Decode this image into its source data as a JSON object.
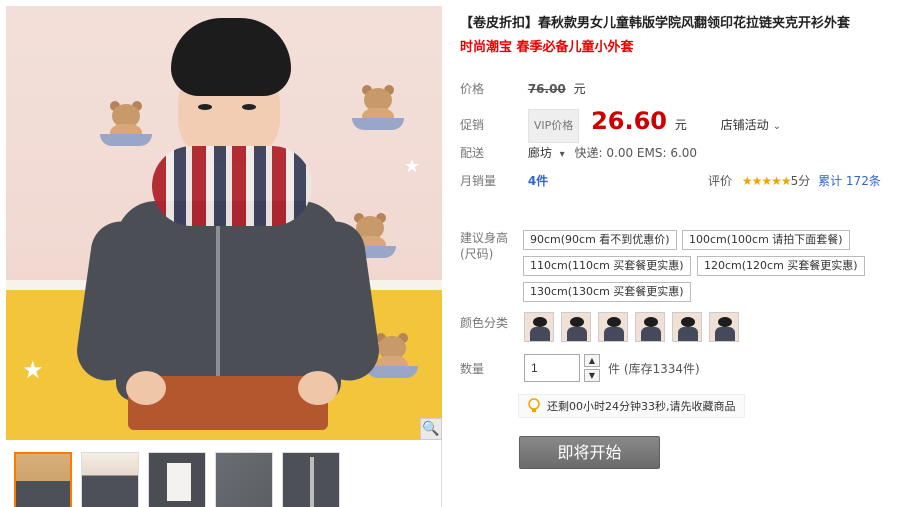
{
  "product": {
    "title": "【卷皮折扣】春秋款男女儿童韩版学院风翻领印花拉链夹克开衫外套",
    "subtitle": "时尚潮宝 春季必备儿童小外套"
  },
  "price": {
    "label": "价格",
    "original": "76.00",
    "unit": "元"
  },
  "promo": {
    "label": "促销",
    "vip_tag": "VIP价格",
    "price": "26.60",
    "unit": "元",
    "store_activity": "店铺活动",
    "dropdown_glyph": "⌄"
  },
  "shipping": {
    "label": "配送",
    "origin": "廊坊",
    "dropdown_glyph": "▾",
    "fee": "快递: 0.00 EMS: 6.00"
  },
  "sales": {
    "label": "月销量",
    "count": "4件",
    "review_label": "评价",
    "stars": "★★★★★",
    "score": "5分",
    "total_reviews": "累计 172条"
  },
  "size": {
    "label": "建议身高(尺码)",
    "options": [
      "90cm(90cm 看不到优惠价)",
      "100cm(100cm 请拍下面套餐)",
      "110cm(110cm 买套餐更实惠)",
      "120cm(120cm 买套餐更实惠)",
      "130cm(130cm 买套餐更实惠)"
    ]
  },
  "color": {
    "label": "颜色分类",
    "swatch_count": 6
  },
  "quantity": {
    "label": "数量",
    "value": "1",
    "up": "▲",
    "down": "▼",
    "stock": "件 (库存1334件)"
  },
  "countdown": {
    "text": "还剩00小时24分钟33秒,请先收藏商品"
  },
  "buy_button": {
    "label": "即将开始"
  },
  "gallery": {
    "zoom_glyph": "🔍"
  },
  "colors": {
    "price_red": "#cc0000",
    "link_blue": "#3366cc",
    "subtitle_red": "#ee0000",
    "star_gold": "#f0a400",
    "button_gray": "#7a7a7a"
  }
}
